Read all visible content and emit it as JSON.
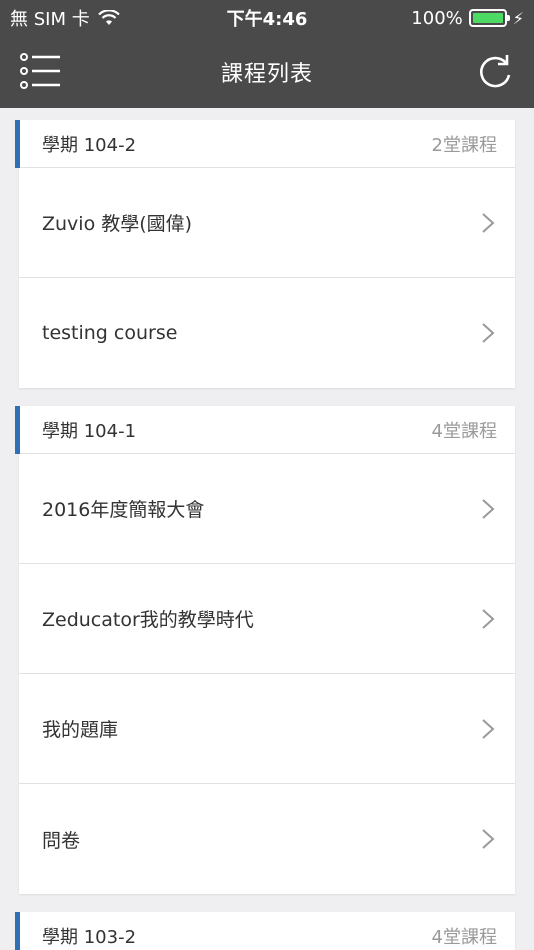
{
  "status_bar": {
    "carrier": "無 SIM 卡",
    "time": "下午4:46",
    "battery": "100%",
    "battery_level": 1.0,
    "battery_color": "#4cd964"
  },
  "nav": {
    "title": "課程列表",
    "menu_icon": "list-menu-icon",
    "refresh_icon": "refresh-icon"
  },
  "sections": [
    {
      "term": "學期 104-2",
      "count": "2堂課程",
      "courses": [
        "Zuvio 教學(國偉)",
        "testing course"
      ]
    },
    {
      "term": "學期 104-1",
      "count": "4堂課程",
      "courses": [
        "2016年度簡報大會",
        "Zeducator我的教學時代",
        "我的題庫",
        "問卷"
      ]
    },
    {
      "term": "學期 103-2",
      "count": "4堂課程",
      "courses": []
    }
  ],
  "colors": {
    "nav_bg": "#4a4a4a",
    "accent": "#2f6fb3",
    "page_bg": "#efeff1"
  }
}
